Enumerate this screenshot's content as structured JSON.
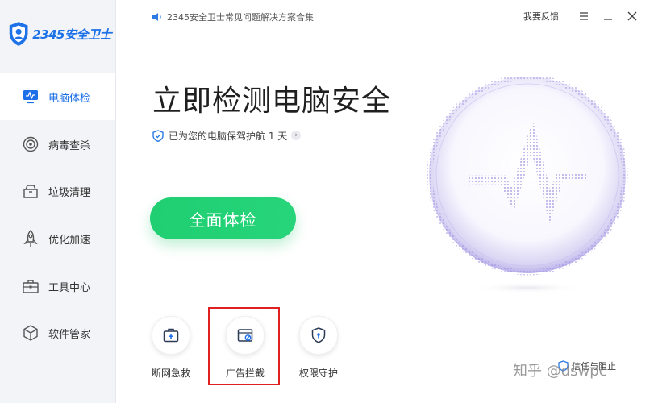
{
  "app": {
    "logo_text": "2345安全卫士"
  },
  "topbar": {
    "notice": "2345安全卫士常见问题解决方案合集",
    "feedback": "我要反馈"
  },
  "sidebar": {
    "items": [
      {
        "label": "电脑体检",
        "icon": "monitor-icon"
      },
      {
        "label": "病毒查杀",
        "icon": "target-icon"
      },
      {
        "label": "垃圾清理",
        "icon": "trash-box-icon"
      },
      {
        "label": "优化加速",
        "icon": "rocket-icon"
      },
      {
        "label": "工具中心",
        "icon": "toolbox-icon"
      },
      {
        "label": "软件管家",
        "icon": "cube-icon"
      }
    ],
    "active_index": 0
  },
  "main": {
    "headline": "立即检测电脑安全",
    "status": "已为您的电脑保驾护航 1 天",
    "scan_button": "全面体检"
  },
  "tools": [
    {
      "label": "断网急救",
      "icon": "first-aid-icon"
    },
    {
      "label": "广告拦截",
      "icon": "ad-block-icon"
    },
    {
      "label": "权限守护",
      "icon": "shield-lock-icon"
    }
  ],
  "footer": {
    "trust_text": "信任与阻止",
    "watermark": "知乎 @dswpc"
  },
  "colors": {
    "accent_blue": "#1c6fe6",
    "scan_green": "#1fcf71",
    "highlight_red": "#e02020",
    "orb_purple": "#8b83d6"
  }
}
